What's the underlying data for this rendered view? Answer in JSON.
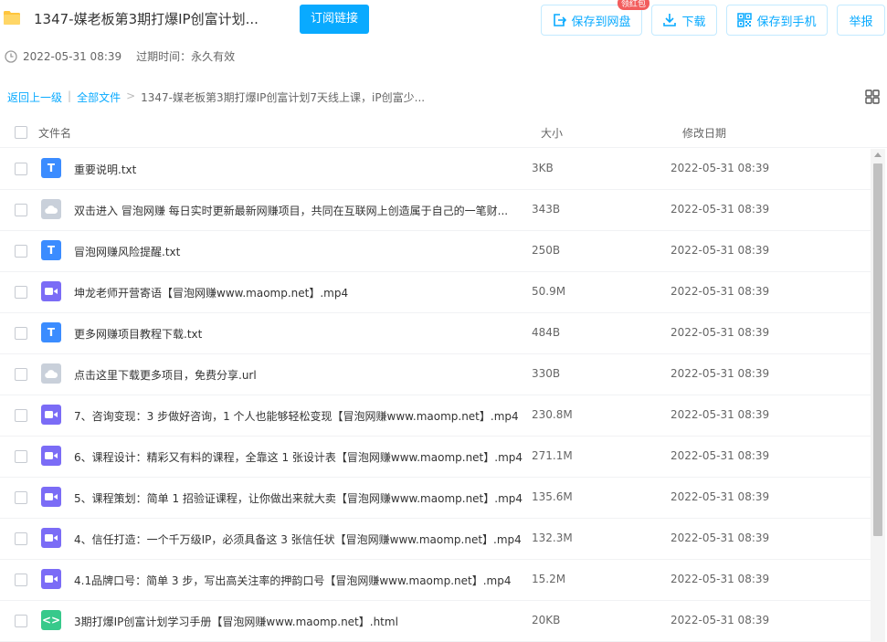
{
  "header": {
    "title": "1347-媒老板第3期打爆IP创富计划...",
    "subscribe_label": "订阅链接",
    "save_disk_label": "保存到网盘",
    "redpacket_label": "领红包",
    "download_label": "下载",
    "save_phone_label": "保存到手机",
    "report_label": "举报"
  },
  "meta": {
    "date": "2022-05-31 08:39",
    "expire": "过期时间：永久有效"
  },
  "breadcrumb": {
    "back": "返回上一级",
    "sep1": "|",
    "all": "全部文件",
    "sep2": ">",
    "current": "1347-媒老板第3期打爆IP创富计划7天线上课，iP创富少..."
  },
  "table": {
    "col_name": "文件名",
    "col_size": "大小",
    "col_date": "修改日期",
    "rows": [
      {
        "type": "txt",
        "icon_text": "T",
        "name": "重要说明.txt",
        "size": "3KB",
        "date": "2022-05-31 08:39"
      },
      {
        "type": "url",
        "icon_text": "",
        "name": "双击进入 冒泡网赚 每日实时更新最新网赚项目，共同在互联网上创造属于自己的一笔财...",
        "size": "343B",
        "date": "2022-05-31 08:39"
      },
      {
        "type": "txt",
        "icon_text": "T",
        "name": "冒泡网赚风险提醒.txt",
        "size": "250B",
        "date": "2022-05-31 08:39"
      },
      {
        "type": "mp4",
        "icon_text": "",
        "name": "坤龙老师开营寄语【冒泡网赚www.maomp.net】.mp4",
        "size": "50.9M",
        "date": "2022-05-31 08:39"
      },
      {
        "type": "txt",
        "icon_text": "T",
        "name": "更多网赚项目教程下载.txt",
        "size": "484B",
        "date": "2022-05-31 08:39"
      },
      {
        "type": "url",
        "icon_text": "",
        "name": "点击这里下载更多项目，免费分享.url",
        "size": "330B",
        "date": "2022-05-31 08:39"
      },
      {
        "type": "mp4",
        "icon_text": "",
        "name": "7、咨询变现：3 步做好咨询，1 个人也能够轻松变现【冒泡网赚www.maomp.net】.mp4",
        "size": "230.8M",
        "date": "2022-05-31 08:39"
      },
      {
        "type": "mp4",
        "icon_text": "",
        "name": "6、课程设计：精彩又有料的课程，全靠这 1 张设计表【冒泡网赚www.maomp.net】.mp4",
        "size": "271.1M",
        "date": "2022-05-31 08:39"
      },
      {
        "type": "mp4",
        "icon_text": "",
        "name": "5、课程策划：简单 1 招验证课程，让你做出来就大卖【冒泡网赚www.maomp.net】.mp4",
        "size": "135.6M",
        "date": "2022-05-31 08:39"
      },
      {
        "type": "mp4",
        "icon_text": "",
        "name": "4、信任打造：一个千万级IP，必须具备这 3 张信任状【冒泡网赚www.maomp.net】.mp4",
        "size": "132.3M",
        "date": "2022-05-31 08:39"
      },
      {
        "type": "mp4",
        "icon_text": "",
        "name": "4.1品牌口号：简单 3 步，写出高关注率的押韵口号【冒泡网赚www.maomp.net】.mp4",
        "size": "15.2M",
        "date": "2022-05-31 08:39"
      },
      {
        "type": "html",
        "icon_text": "<>",
        "name": "3期打爆IP创富计划学习手册【冒泡网赚www.maomp.net】.html",
        "size": "20KB",
        "date": "2022-05-31 08:39"
      }
    ]
  },
  "colors": {
    "accent": "#09aaff",
    "txt_icon": "#3b8cff",
    "url_icon": "#c9d0da",
    "mp4_icon": "#7b6cf6",
    "html_icon": "#37c98b",
    "redpacket": "#f25d5d"
  },
  "icons": {
    "folder": "folder-icon",
    "clock": "clock-icon",
    "grid_view": "grid-view-icon",
    "save": "save-to-disk-icon",
    "download": "download-icon",
    "qrcode": "qrcode-icon"
  }
}
